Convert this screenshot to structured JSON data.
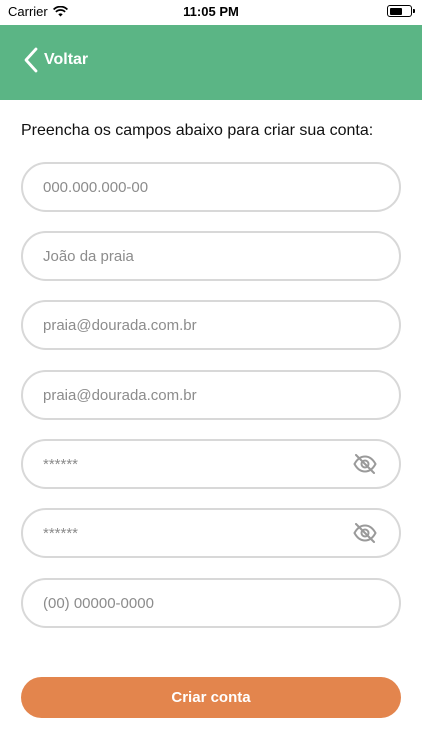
{
  "status_bar": {
    "carrier": "Carrier",
    "time": "11:05 PM"
  },
  "header": {
    "back_label": "Voltar",
    "background": "#5bb585"
  },
  "form": {
    "instructions": "Preencha os campos abaixo para criar sua conta:",
    "fields": [
      {
        "placeholder": "000.000.000-00"
      },
      {
        "placeholder": "João da praia"
      },
      {
        "placeholder": "praia@dourada.com.br"
      },
      {
        "placeholder": "praia@dourada.com.br"
      },
      {
        "placeholder": "******",
        "icon": "eye-off-icon"
      },
      {
        "placeholder": "******",
        "icon": "eye-off-icon"
      },
      {
        "placeholder": "(00) 00000-0000"
      }
    ],
    "submit_label": "Criar conta",
    "submit_color": "#e3854d"
  }
}
